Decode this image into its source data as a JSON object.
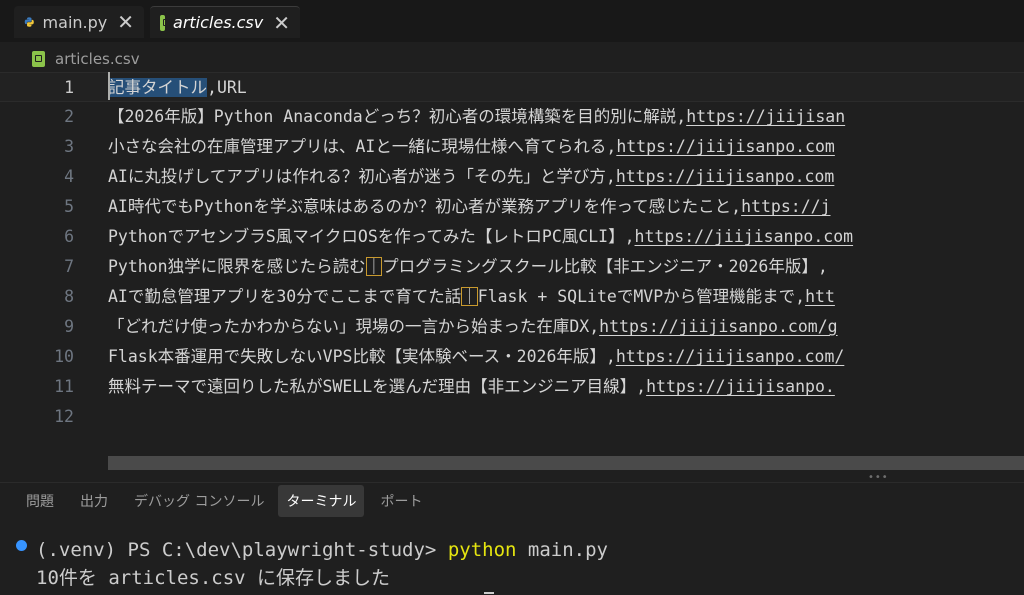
{
  "tabs": [
    {
      "label": "main.py",
      "icon": "python-icon",
      "active": false
    },
    {
      "label": "articles.csv",
      "icon": "csv-file-icon",
      "active": true
    }
  ],
  "breadcrumb": {
    "label": "articles.csv"
  },
  "editor": {
    "line_numbers": [
      "1",
      "2",
      "3",
      "4",
      "5",
      "6",
      "7",
      "8",
      "9",
      "10",
      "11",
      "12"
    ],
    "lines": [
      {
        "title": "記事タイトル",
        "url": "URL"
      },
      {
        "title": "【2026年版】Python Anacondaどっち？初心者の環境構築を目的別に解説",
        "url": "https://jiijisan"
      },
      {
        "title": "小さな会社の在庫管理アプリは、AIと一緒に現場仕様へ育てられる",
        "url": "https://jiijisanpo.com"
      },
      {
        "title": "AIに丸投げしてアプリは作れる？初心者が迷う「その先」と学び方",
        "url": "https://jiijisanpo.com"
      },
      {
        "title": "AI時代でもPythonを学ぶ意味はあるのか？初心者が業務アプリを作って感じたこと",
        "url": "https://j"
      },
      {
        "title": "PythonでアセンブラS風マイクロOSを作ってみた【レトロPC風CLI】",
        "url": "https://jiijisanpo.com"
      },
      {
        "title_before": "Python独学に限界を感じたら読む",
        "box_char": "｜",
        "title_after": "プログラミングスクール比較【非エンジニア・2026年版】",
        "url": ""
      },
      {
        "title_before": "AIで勤怠管理アプリを30分でここまで育てた話",
        "box_char": "｜",
        "title_after": "Flask + SQLiteでMVPから管理機能まで",
        "url": "htt"
      },
      {
        "title": "「どれだけ使ったかわからない」現場の一言から始まった在庫DX",
        "url": "https://jiijisanpo.com/g"
      },
      {
        "title": "Flask本番運用で失敗しないVPS比較【実体験ベース・2026年版】",
        "url": "https://jiijisanpo.com/"
      },
      {
        "title": "無料テーマで遠回りした私がSWELLを選んだ理由【非エンジニア目線】",
        "url": "https://jiijisanpo."
      },
      {
        "title": "",
        "url": ""
      }
    ]
  },
  "panel": {
    "tabs": [
      "問題",
      "出力",
      "デバッグ コンソール",
      "ターミナル",
      "ポート"
    ],
    "active_tab": "ターミナル"
  },
  "terminal": {
    "prompt": "(.venv) PS C:\\dev\\playwright-study>",
    "command": "python",
    "args": "main.py",
    "output": "10件を articles.csv に保存しました"
  },
  "colors": {
    "accent": "#3794ff",
    "command": "#e5e510",
    "csv_icon": "#8bc34a"
  }
}
